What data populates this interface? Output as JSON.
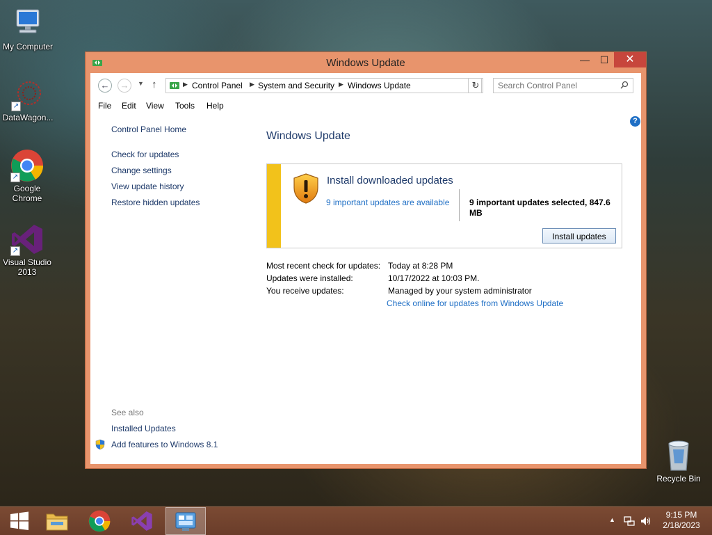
{
  "desktop": {
    "icons": [
      {
        "label": "My Computer"
      },
      {
        "label": "DataWagon..."
      },
      {
        "label": "Google Chrome"
      },
      {
        "label": "Visual Studio 2013"
      }
    ],
    "recycle_bin": {
      "label": "Recycle Bin"
    }
  },
  "window": {
    "title": "Windows Update",
    "controls": {
      "minimize": "—",
      "maximize": "☐",
      "close": "✕"
    },
    "address": {
      "crumbs": [
        "Control Panel",
        "System and Security",
        "Windows Update"
      ]
    },
    "search": {
      "placeholder": "Search Control Panel"
    },
    "menu": [
      "File",
      "Edit",
      "View",
      "Tools",
      "Help"
    ],
    "sidebar": {
      "home": "Control Panel Home",
      "links": [
        "Check for updates",
        "Change settings",
        "View update history",
        "Restore hidden updates"
      ],
      "see_also_heading": "See also",
      "see_also": [
        "Installed Updates",
        "Add features to Windows 8.1"
      ]
    },
    "main": {
      "title": "Windows Update",
      "panel": {
        "title": "Install downloaded updates",
        "available_link": "9 important updates are available",
        "selected_summary": "9 important updates selected, 847.6 MB",
        "install_button": "Install updates"
      },
      "info": [
        {
          "label": "Most recent check for updates:",
          "value": "Today at 8:28 PM"
        },
        {
          "label": "Updates were installed:",
          "value": "10/17/2022 at 10:03 PM."
        },
        {
          "label": "You receive updates:",
          "value": "Managed by your system administrator"
        }
      ],
      "online_link": "Check online for updates from Windows Update"
    }
  },
  "taskbar": {
    "items": [
      {
        "name": "start",
        "icon": "windows-logo-icon"
      },
      {
        "name": "file-explorer",
        "icon": "folder-icon"
      },
      {
        "name": "chrome",
        "icon": "chrome-icon"
      },
      {
        "name": "visual-studio",
        "icon": "visual-studio-icon"
      },
      {
        "name": "control-panel",
        "icon": "control-panel-icon",
        "active": true
      }
    ],
    "clock": {
      "time": "9:15 PM",
      "date": "2/18/2023"
    }
  },
  "colors": {
    "window_frame": "#e8946c",
    "link": "#1f6fc5",
    "heading": "#1e3a6a",
    "panel_stripe": "#f2c21b",
    "close_button": "#c7463c"
  }
}
